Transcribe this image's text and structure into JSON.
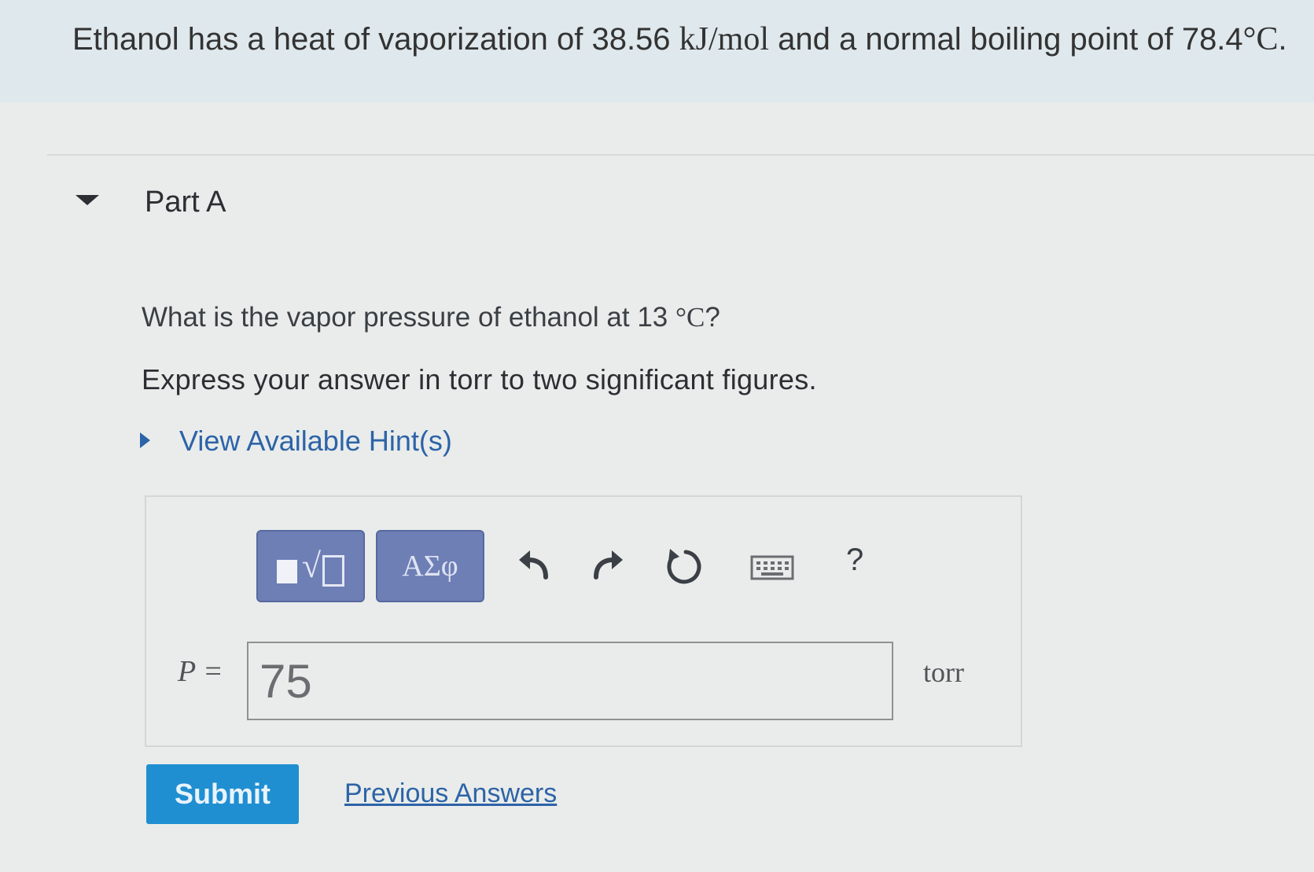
{
  "problem": {
    "text_before_value1": "Ethanol has a heat of vaporization of 38.56 ",
    "unit1": "kJ/mol",
    "text_middle": " and a normal boiling point of 78.4",
    "unit2": "°C",
    "text_end": "."
  },
  "part": {
    "title": "Part A",
    "question_prefix": "What is the vapor pressure of ethanol at 13 ",
    "question_unit": "°C",
    "question_suffix": "?",
    "instruction": "Express your answer in torr to two significant figures.",
    "hint_label": "View Available Hint(s)"
  },
  "toolbar": {
    "symbols_label": "ΑΣφ",
    "help_label": "?",
    "icons": [
      "templates-icon",
      "symbols-icon",
      "undo-icon",
      "redo-icon",
      "reset-icon",
      "keyboard-icon",
      "help-icon"
    ]
  },
  "answer": {
    "variable_label": "P =",
    "value": "75",
    "unit": "torr"
  },
  "actions": {
    "submit_label": "Submit",
    "previous_answers_label": "Previous Answers"
  },
  "colors": {
    "accent": "#1f8fd1",
    "link": "#2d63a8",
    "toolbar_button": "#6e7fb6",
    "banner": "#dfe8ec"
  }
}
